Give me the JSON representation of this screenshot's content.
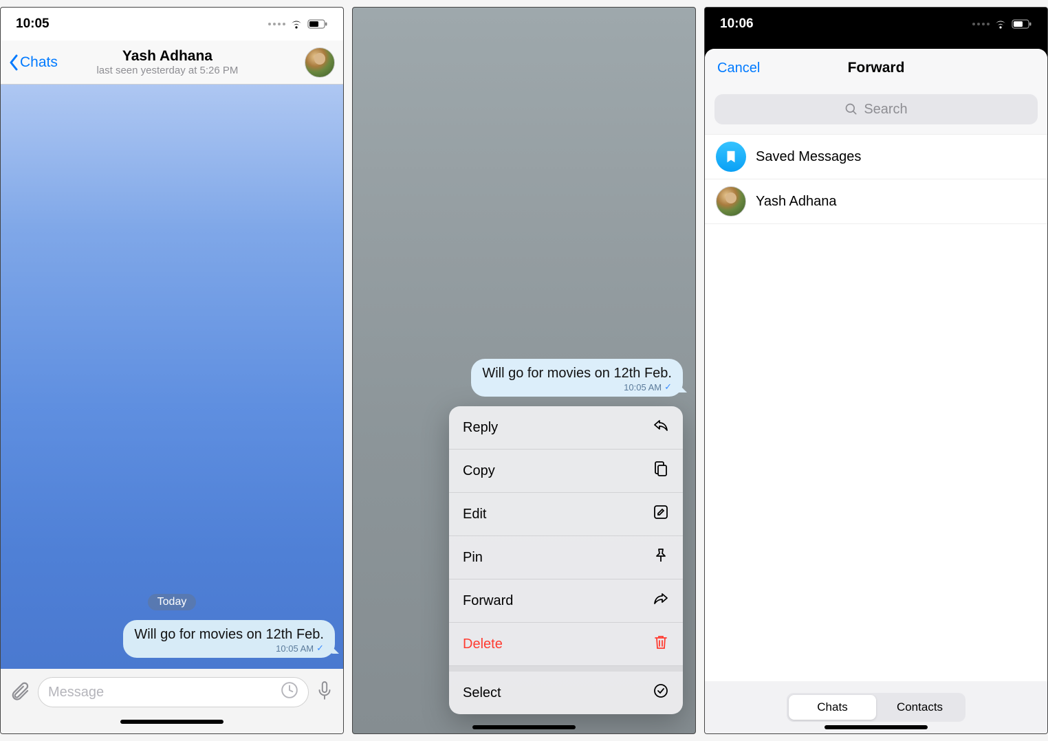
{
  "screen1": {
    "time": "10:05",
    "back_label": "Chats",
    "contact_name": "Yash Adhana",
    "contact_status": "last seen yesterday at 5:26 PM",
    "date_divider": "Today",
    "message_text": "Will go for movies on 12th Feb.",
    "message_time": "10:05 AM",
    "input_placeholder": "Message"
  },
  "screen2": {
    "message_text": "Will go for movies on 12th Feb.",
    "message_time": "10:05 AM",
    "menu": {
      "reply": "Reply",
      "copy": "Copy",
      "edit": "Edit",
      "pin": "Pin",
      "forward": "Forward",
      "delete": "Delete",
      "select": "Select"
    }
  },
  "screen3": {
    "time": "10:06",
    "cancel": "Cancel",
    "title": "Forward",
    "search_placeholder": "Search",
    "rows": {
      "saved": "Saved Messages",
      "contact": "Yash Adhana"
    },
    "segments": {
      "chats": "Chats",
      "contacts": "Contacts"
    }
  }
}
